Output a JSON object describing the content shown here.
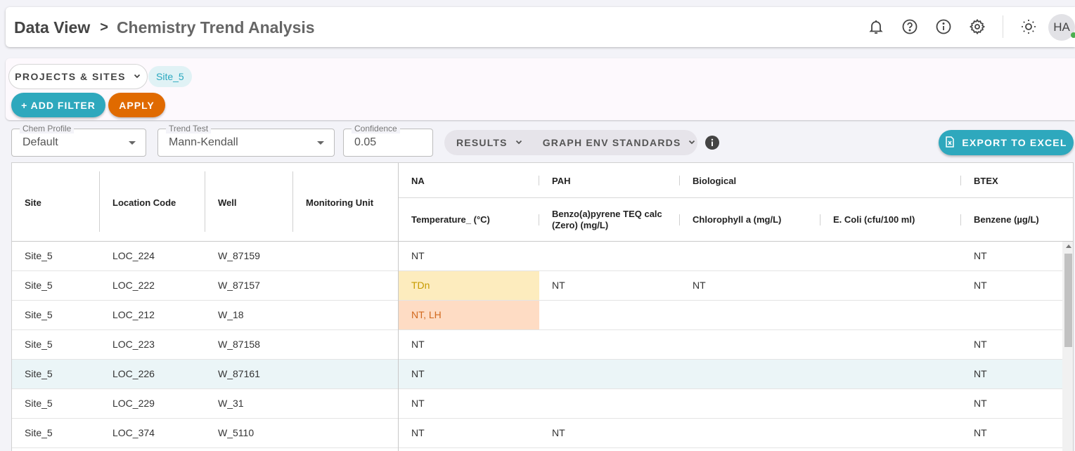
{
  "header": {
    "breadcrumb_root": "Data View",
    "breadcrumb_sep": ">",
    "breadcrumb_current": "Chemistry Trend Analysis",
    "avatar_initials": "HA",
    "icons": [
      "bell-icon",
      "help-icon",
      "info-icon",
      "gear-icon",
      "brightness-icon"
    ]
  },
  "filters": {
    "projects_label": "PROJECTS & SITES",
    "site_chip": "Site_5",
    "add_filter_label": "+ ADD FILTER",
    "apply_label": "APPLY"
  },
  "controls": {
    "chem_profile": {
      "label": "Chem Profile",
      "value": "Default"
    },
    "trend_test": {
      "label": "Trend Test",
      "value": "Mann-Kendall"
    },
    "confidence": {
      "label": "Confidence",
      "value": "0.05"
    },
    "results_label": "RESULTS",
    "graph_env_label": "GRAPH ENV STANDARDS",
    "export_label": "EXPORT TO EXCEL"
  },
  "table": {
    "pinned_headers": [
      "Site",
      "Location Code",
      "Well",
      "Monitoring Unit"
    ],
    "groups": [
      "NA",
      "PAH",
      "Biological",
      "BTEX"
    ],
    "columns": [
      "Temperature_ (°C)",
      "Benzo(a)pyrene TEQ calc (Zero) (mg/L)",
      "Chlorophyll a (mg/L)",
      "E. Coli (cfu/100 ml)",
      "Benzene (µg/L)"
    ],
    "rows": [
      {
        "site": "Site_5",
        "loc": "LOC_224",
        "well": "W_87159",
        "unit": "",
        "temp": "NT",
        "bap": "",
        "chl": "",
        "ecoli": "",
        "benzene": "NT"
      },
      {
        "site": "Site_5",
        "loc": "LOC_222",
        "well": "W_87157",
        "unit": "",
        "temp": "TDn",
        "bap": "NT",
        "chl": "NT",
        "ecoli": "",
        "benzene": "NT"
      },
      {
        "site": "Site_5",
        "loc": "LOC_212",
        "well": "W_18",
        "unit": "",
        "temp": "NT, LH",
        "bap": "",
        "chl": "",
        "ecoli": "",
        "benzene": ""
      },
      {
        "site": "Site_5",
        "loc": "LOC_223",
        "well": "W_87158",
        "unit": "",
        "temp": "NT",
        "bap": "",
        "chl": "",
        "ecoli": "",
        "benzene": "NT"
      },
      {
        "site": "Site_5",
        "loc": "LOC_226",
        "well": "W_87161",
        "unit": "",
        "temp": "NT",
        "bap": "",
        "chl": "",
        "ecoli": "",
        "benzene": "NT"
      },
      {
        "site": "Site_5",
        "loc": "LOC_229",
        "well": "W_31",
        "unit": "",
        "temp": "NT",
        "bap": "",
        "chl": "",
        "ecoli": "",
        "benzene": "NT"
      },
      {
        "site": "Site_5",
        "loc": "LOC_374",
        "well": "W_5110",
        "unit": "",
        "temp": "NT",
        "bap": "NT",
        "chl": "",
        "ecoli": "",
        "benzene": "NT"
      }
    ]
  },
  "colors": {
    "accent_teal": "#2ea8bd",
    "apply_orange": "#e06a00",
    "trend_down_bg": "#fdecbe",
    "trend_high_bg": "#fedcc4",
    "status_online": "#4caf50"
  }
}
